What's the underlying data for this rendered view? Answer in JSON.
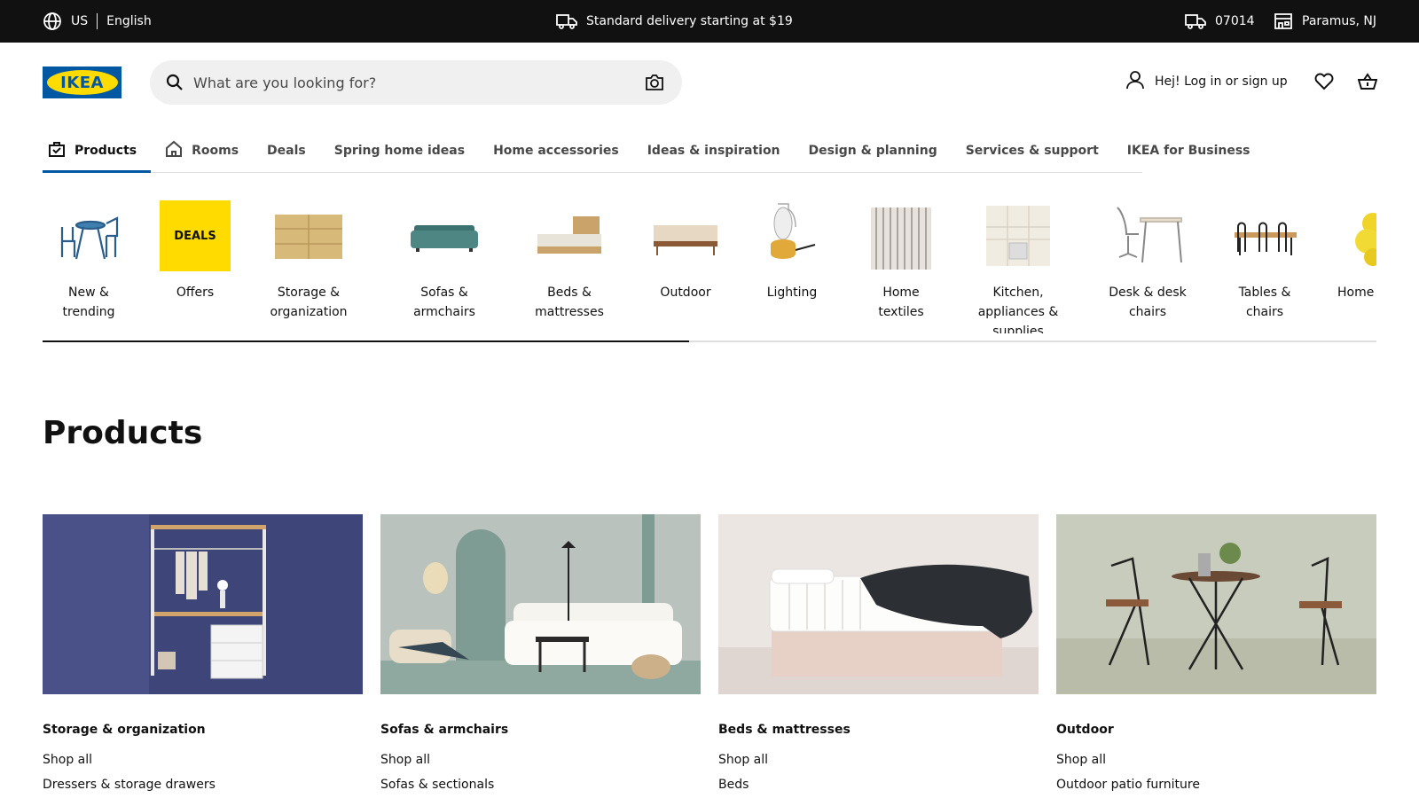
{
  "topbar": {
    "region": "US",
    "language": "English",
    "delivery": "Standard delivery starting at $19",
    "zip": "07014",
    "store": "Paramus, NJ"
  },
  "header": {
    "logo_text": "IKEA",
    "search_placeholder": "What are you looking for?",
    "account_label": "Hej! Log in or sign up"
  },
  "nav": {
    "tabs": [
      {
        "label": "Products"
      },
      {
        "label": "Rooms"
      },
      {
        "label": "Deals"
      },
      {
        "label": "Spring home ideas"
      },
      {
        "label": "Home accessories"
      },
      {
        "label": "Ideas & inspiration"
      },
      {
        "label": "Design & planning"
      },
      {
        "label": "Services & support"
      },
      {
        "label": "IKEA for Business"
      }
    ]
  },
  "categories": [
    {
      "label": "New & trending"
    },
    {
      "label": "Offers",
      "badge": "DEALS"
    },
    {
      "label": "Storage & organization"
    },
    {
      "label": "Sofas & armchairs"
    },
    {
      "label": "Beds & mattresses"
    },
    {
      "label": "Outdoor"
    },
    {
      "label": "Lighting"
    },
    {
      "label": "Home textiles"
    },
    {
      "label": "Kitchen, appliances & supplies"
    },
    {
      "label": "Desk & desk chairs"
    },
    {
      "label": "Tables & chairs"
    },
    {
      "label": "Home acce"
    }
  ],
  "main": {
    "title": "Products",
    "cards": [
      {
        "title": "Storage & organization",
        "links": [
          "Shop all",
          "Dressers & storage drawers"
        ]
      },
      {
        "title": "Sofas & armchairs",
        "links": [
          "Shop all",
          "Sofas & sectionals"
        ]
      },
      {
        "title": "Beds & mattresses",
        "links": [
          "Shop all",
          "Beds"
        ]
      },
      {
        "title": "Outdoor",
        "links": [
          "Shop all",
          "Outdoor patio furniture"
        ]
      }
    ]
  },
  "colors": {
    "brand_blue": "#0058a3",
    "brand_yellow": "#ffdb00",
    "topbar_bg": "#111111"
  }
}
